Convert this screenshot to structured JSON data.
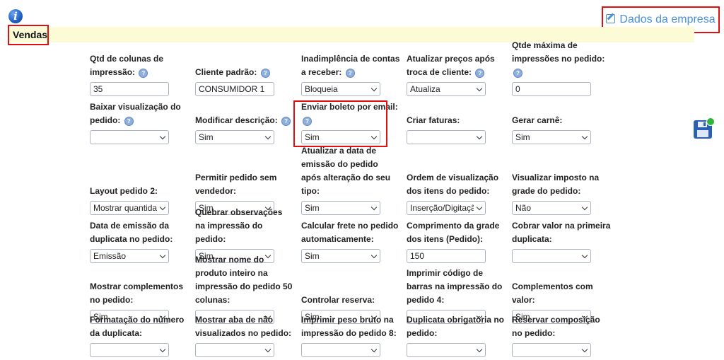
{
  "header": {
    "section_title": "Vendas",
    "company_link": "Dados da empresa"
  },
  "icons": {
    "info": "info-icon",
    "edit": "edit-icon",
    "save": "save-icon",
    "help": "help-icon",
    "chevron": "chevron-down-icon"
  },
  "colors": {
    "highlight": "#e01010",
    "section_bar": "#fdfbd6",
    "link": "#4a90d9"
  },
  "fields": {
    "r0c0": {
      "label": "Qtd de colunas de impressão:",
      "help": true,
      "type": "input",
      "value": "35"
    },
    "r0c1": {
      "label": "Cliente padrão:",
      "help": true,
      "type": "input",
      "value": "CONSUMIDOR 1"
    },
    "r0c2": {
      "label": "Inadimplência de contas a receber:",
      "help": true,
      "type": "select",
      "value": "Bloqueia"
    },
    "r0c3": {
      "label": "Atualizar preços após troca de cliente:",
      "help": true,
      "type": "select",
      "value": "Atualiza"
    },
    "r0c4": {
      "label": "Qtde máxima de impressões no pedido:",
      "help": true,
      "type": "input",
      "value": "0"
    },
    "r1c0": {
      "label": "Baixar visualização do pedido:",
      "help": true,
      "type": "select",
      "value": ""
    },
    "r1c1": {
      "label": "Modificar descrição:",
      "help": true,
      "type": "select",
      "value": "Sim"
    },
    "r1c2": {
      "label": "Enviar boleto por email:",
      "help": true,
      "type": "select",
      "value": "Sim"
    },
    "r1c3": {
      "label": "Criar faturas:",
      "help": false,
      "type": "select",
      "value": ""
    },
    "r1c4": {
      "label": "Gerar carnê:",
      "help": false,
      "type": "select",
      "value": "Sim"
    },
    "r2c0": {
      "label": "Layout pedido 2:",
      "help": false,
      "type": "select",
      "value": "Mostrar quantidade"
    },
    "r2c1": {
      "label": "Permitir pedido sem vendedor:",
      "help": false,
      "type": "select",
      "value": "Sim"
    },
    "r2c2": {
      "label": "Atualizar a data de emissão do pedido após alteração do seu tipo:",
      "help": false,
      "type": "select",
      "value": "Sim"
    },
    "r2c3": {
      "label": "Ordem de visualização dos itens do pedido:",
      "help": false,
      "type": "select",
      "value": "Inserção/Digitação"
    },
    "r2c4": {
      "label": "Visualizar imposto na grade do pedido:",
      "help": false,
      "type": "select",
      "value": "Não"
    },
    "r3c0": {
      "label": "Data de emissão da duplicata no pedido:",
      "help": false,
      "type": "select",
      "value": "Emissão"
    },
    "r3c1": {
      "label": "Quebrar observações na impressão do pedido:",
      "help": false,
      "type": "select",
      "value": "Sim"
    },
    "r3c2": {
      "label": "Calcular frete no pedido automaticamente:",
      "help": false,
      "type": "select",
      "value": "Sim"
    },
    "r3c3": {
      "label": "Comprimento da grade dos itens (Pedido):",
      "help": false,
      "type": "input",
      "value": "150"
    },
    "r3c4": {
      "label": "Cobrar valor na primeira duplicata:",
      "help": false,
      "type": "select",
      "value": ""
    },
    "r4c0": {
      "label": "Mostrar complementos no pedido:",
      "help": false,
      "type": "select",
      "value": "Sim"
    },
    "r4c1": {
      "label": "Mostrar nome do produto inteiro na impressão do pedido 50 colunas:",
      "help": false,
      "type": "select",
      "value": ""
    },
    "r4c2": {
      "label": "Controlar reserva:",
      "help": false,
      "type": "select",
      "value": "Sim"
    },
    "r4c3": {
      "label": "Imprimir código de barras na impressão do pedido 4:",
      "help": false,
      "type": "select",
      "value": ""
    },
    "r4c4": {
      "label": "Complementos com valor:",
      "help": false,
      "type": "select",
      "value": "Sim"
    },
    "r5c0": {
      "label": "Formatação do número da duplicata:",
      "help": false,
      "type": "select",
      "value": ""
    },
    "r5c1": {
      "label": "Mostrar aba de não visualizados no pedido:",
      "help": false,
      "type": "select",
      "value": ""
    },
    "r5c2": {
      "label": "Imprimir peso bruto na impressão do pedido 8:",
      "help": false,
      "type": "select",
      "value": ""
    },
    "r5c3": {
      "label": "Duplicata obrigatória no pedido:",
      "help": false,
      "type": "select",
      "value": ""
    },
    "r5c4": {
      "label": "Reservar composição no pedido:",
      "help": false,
      "type": "select",
      "value": ""
    }
  }
}
